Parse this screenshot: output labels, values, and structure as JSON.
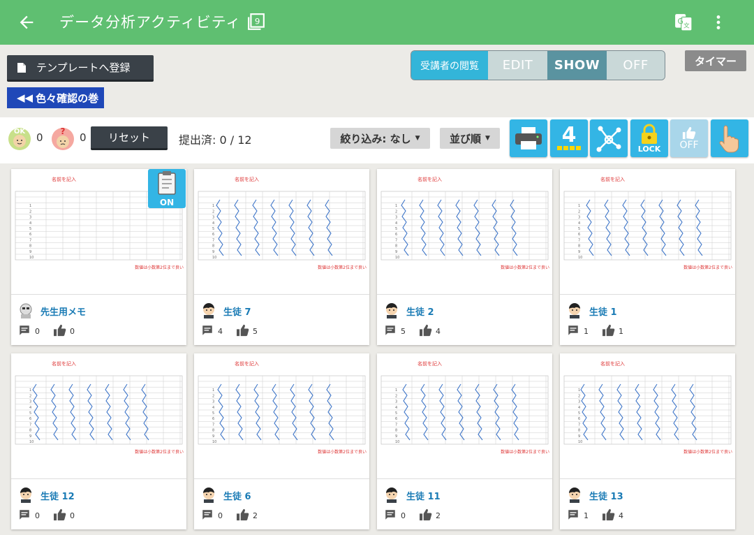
{
  "appbar": {
    "title": "データ分析アクティビティ",
    "icons": [
      "back-arrow-icon",
      "page-number-icon",
      "translate-icon",
      "more-vertical-icon"
    ]
  },
  "toolbar": {
    "template_button": "テンプレートへ登録",
    "book_button": "色々確認の巻",
    "view_label": "受講者の閲覧",
    "view_options": [
      "EDIT",
      "SHOW",
      "OFF"
    ],
    "view_selected": "SHOW",
    "timer_button": "タイマー"
  },
  "filterrow": {
    "ok_count": "0",
    "question_count": "0",
    "reset_button": "リセット",
    "submitted": "提出済: 0 / 12",
    "filter_button": "絞り込み: なし",
    "sort_button": "並び順",
    "tools": [
      "printer-icon",
      "grid-4-icon",
      "network-icon",
      "lock-icon",
      "thumbs-up-off-icon",
      "hand-pointer-icon"
    ],
    "lock_label": "LOCK",
    "off_label": "OFF",
    "grid_label": "4"
  },
  "cards": [
    {
      "name": "先生用メモ",
      "comments": "0",
      "likes": "0",
      "teacher": true,
      "on_label": "ON"
    },
    {
      "name": "生徒 7",
      "comments": "4",
      "likes": "5"
    },
    {
      "name": "生徒 2",
      "comments": "5",
      "likes": "4"
    },
    {
      "name": "生徒 1",
      "comments": "1",
      "likes": "1"
    },
    {
      "name": "生徒 12",
      "comments": "0",
      "likes": "0"
    },
    {
      "name": "生徒 6",
      "comments": "0",
      "likes": "2"
    },
    {
      "name": "生徒 11",
      "comments": "0",
      "likes": "2"
    },
    {
      "name": "生徒 13",
      "comments": "1",
      "likes": "4"
    }
  ],
  "sheet": {
    "title": "名前を記入",
    "note": "数値は小数第2位まで良い"
  },
  "colors": {
    "appbar": "#5fbf71",
    "accent": "#33b5e5",
    "dark_button": "#3a4148",
    "link": "#1a7bb5"
  }
}
